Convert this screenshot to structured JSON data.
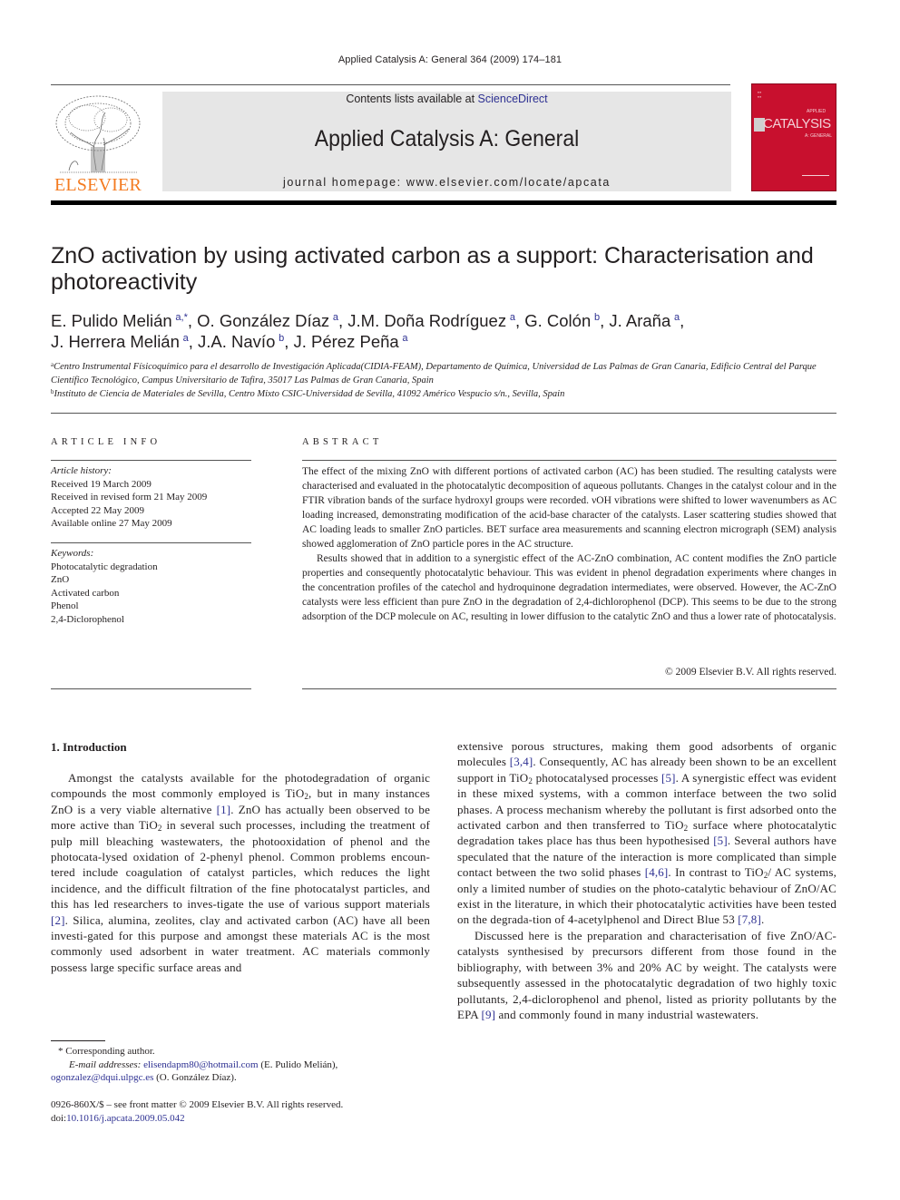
{
  "running_head": "Applied Catalysis A: General 364 (2009) 174–181",
  "masthead": {
    "publisher": "ELSEVIER",
    "contents_prefix": "Contents lists available at ",
    "contents_link": "ScienceDirect",
    "journal_title": "Applied Catalysis A: General",
    "homepage": "journal homepage: www.elsevier.com/locate/apcata",
    "cover": {
      "title": "CATALYSIS",
      "sub_top": "APPLIED",
      "sub_bottom": "A: GENERAL",
      "color": "#c8102e"
    }
  },
  "article": {
    "title": "ZnO activation by using activated carbon as a support: Characterisation and photoreactivity",
    "authors": [
      {
        "name": "E. Pulido Melián",
        "aff": "a,*",
        "sep": ", "
      },
      {
        "name": "O. González Díaz",
        "aff": "a",
        "sep": ", "
      },
      {
        "name": "J.M. Doña Rodríguez",
        "aff": "a",
        "sep": ", "
      },
      {
        "name": "G. Colón",
        "aff": "b",
        "sep": ", "
      },
      {
        "name": "J. Araña",
        "aff": "a",
        "sep": ","
      },
      {
        "name": "J. Herrera Melián",
        "aff": "a",
        "sep": ", "
      },
      {
        "name": "J.A. Navío",
        "aff": "b",
        "sep": ", "
      },
      {
        "name": "J. Pérez Peña",
        "aff": "a",
        "sep": ""
      }
    ],
    "affiliations": [
      {
        "mark": "a",
        "text": "Centro Instrumental Físicoquímico para el desarrollo de Investigación Aplicada(CIDIA-FEAM), Departamento de Química, Universidad de Las Palmas de Gran Canaria, Edificio Central del Parque Científico Tecnológico, Campus Universitario de Tafira, 35017 Las Palmas de Gran Canaria, Spain"
      },
      {
        "mark": "b",
        "text": "Instituto de Ciencia de Materiales de Sevilla, Centro Mixto CSIC-Universidad de Sevilla, 41092 Américo Vespucio s/n., Sevilla, Spain"
      }
    ]
  },
  "article_info": {
    "heading": "ARTICLE INFO",
    "history_label": "Article history:",
    "history": [
      "Received 19 March 2009",
      "Received in revised form 21 May 2009",
      "Accepted 22 May 2009",
      "Available online 27 May 2009"
    ],
    "keywords_label": "Keywords:",
    "keywords": [
      "Photocatalytic degradation",
      "ZnO",
      "Activated carbon",
      "Phenol",
      "2,4-Diclorophenol"
    ]
  },
  "abstract": {
    "heading": "ABSTRACT",
    "paragraphs": [
      "The effect of the mixing ZnO with different portions of activated carbon (AC) has been studied. The resulting catalysts were characterised and evaluated in the photocatalytic decomposition of aqueous pollutants. Changes in the catalyst colour and in the FTIR vibration bands of the surface hydroxyl groups were recorded. νOH vibrations were shifted to lower wavenumbers as AC loading increased, demonstrating modification of the acid-base character of the catalysts. Laser scattering studies showed that AC loading leads to smaller ZnO particles. BET surface area measurements and scanning electron micrograph (SEM) analysis showed agglomeration of ZnO particle pores in the AC structure.",
      "Results showed that in addition to a synergistic effect of the AC-ZnO combination, AC content modifies the ZnO particle properties and consequently photocatalytic behaviour. This was evident in phenol degradation experiments where changes in the concentration profiles of the catechol and hydroquinone degradation intermediates, were observed. However, the AC-ZnO catalysts were less efficient than pure ZnO in the degradation of 2,4-dichlorophenol (DCP). This seems to be due to the strong adsorption of the DCP molecule on AC, resulting in lower diffusion to the catalytic ZnO and thus a lower rate of photocatalysis."
    ],
    "copyright": "© 2009 Elsevier B.V. All rights reserved."
  },
  "introduction": {
    "heading": "1.  Introduction",
    "left_p1": [
      {
        "t": "Amongst the catalysts available for the photodegradation of organic compounds the most commonly employed is TiO"
      },
      {
        "sub": "2"
      },
      {
        "t": ", but in many instances ZnO is a very viable alternative "
      },
      {
        "ref": "[1]"
      },
      {
        "t": ". ZnO has actually been observed to be more active than TiO"
      },
      {
        "sub": "2"
      },
      {
        "t": " in several such processes, including the treatment of pulp mill bleaching wastewaters, the photooxidation of phenol and the photocata-lysed oxidation of 2-phenyl phenol. Common problems encoun-tered include coagulation of catalyst particles, which reduces the light incidence, and the difficult filtration of the fine photocatalyst particles, and this has led researchers to inves-tigate the use of various support materials "
      },
      {
        "ref": "[2]"
      },
      {
        "t": ". Silica, alumina, zeolites, clay and activated carbon (AC) have all been investi-gated for this purpose and amongst these materials AC is the most commonly used adsorbent in water treatment. AC materials commonly possess large specific surface areas and"
      }
    ],
    "right_p1": [
      {
        "t": "extensive porous structures, making them good adsorbents of organic molecules "
      },
      {
        "ref": "[3,4]"
      },
      {
        "t": ". Consequently, AC has already been shown to be an excellent support in TiO"
      },
      {
        "sub": "2"
      },
      {
        "t": " photocatalysed processes "
      },
      {
        "ref": "[5]"
      },
      {
        "t": ". A synergistic effect was evident in these mixed systems, with a common interface between the two solid phases. A process mechanism whereby the pollutant is first adsorbed onto the activated carbon and then transferred to TiO"
      },
      {
        "sub": "2"
      },
      {
        "t": " surface where photocatalytic degradation takes place has thus been hypothesised "
      },
      {
        "ref": "[5]"
      },
      {
        "t": ". Several authors have speculated that the nature of the interaction is more complicated than simple contact between the two solid phases "
      },
      {
        "ref": "[4,6]"
      },
      {
        "t": ". In contrast to TiO"
      },
      {
        "sub": "2"
      },
      {
        "t": "/ AC systems, only a limited number of studies on the photo-catalytic behaviour of ZnO/AC exist in the literature, in which their photocatalytic activities have been tested on the degrada-tion of 4-acetylphenol and Direct Blue 53 "
      },
      {
        "ref": "[7,8]"
      },
      {
        "t": "."
      }
    ],
    "right_p2": [
      {
        "t": "Discussed here is the preparation and characterisation of five ZnO/AC-catalysts synthesised by precursors different from those found in the bibliography, with between 3% and 20% AC by weight. The catalysts were subsequently assessed in the photocatalytic degradation of two highly toxic pollutants, 2,4-diclorophenol and phenol, listed as priority pollutants by the EPA "
      },
      {
        "ref": "[9]"
      },
      {
        "t": " and commonly found in many industrial wastewaters."
      }
    ]
  },
  "footnotes": {
    "corresponding": "* Corresponding author.",
    "email_label": "E-mail addresses:",
    "email1": "elisendapm80@hotmail.com",
    "email1_owner": " (E. Pulido Melián),",
    "email2": "ogonzalez@dqui.ulpgc.es",
    "email2_owner": " (O. González Díaz)."
  },
  "front_matter": {
    "issn_line": "0926-860X/$ – see front matter © 2009 Elsevier B.V. All rights reserved.",
    "doi_prefix": "doi:",
    "doi": "10.1016/j.apcata.2009.05.042"
  }
}
